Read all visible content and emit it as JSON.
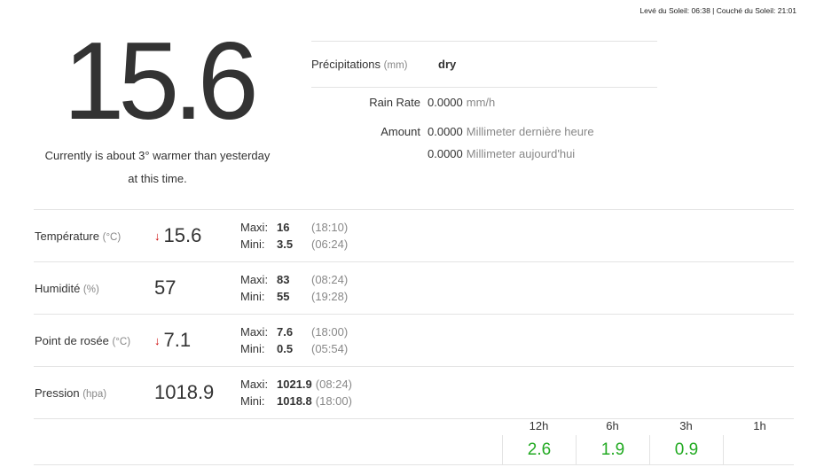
{
  "sun": {
    "text": "Levé du Soleil: 06:38 | Couché du Soleil: 21:01"
  },
  "current": {
    "temperature": "15.6",
    "comparison_line1": "Currently is about 3° warmer than yesterday",
    "comparison_line2": "at this time."
  },
  "rain": {
    "precip_label": "Précipitations",
    "precip_unit": "(mm)",
    "precip_value": "dry",
    "rate_label": "Rain Rate",
    "rate_value": "0.0000",
    "rate_unit": "mm/h",
    "amount_label": "Amount",
    "amount_hour_value": "0.0000",
    "amount_hour_desc": "Millimeter dernière heure",
    "amount_day_value": "0.0000",
    "amount_day_desc": "Millimeter aujourd'hui"
  },
  "observations": [
    {
      "name": "Température",
      "unit": "(°C)",
      "arrow": "↓",
      "value": "15.6",
      "max_label": "Maxi:",
      "max": "16",
      "max_time": "(18:10)",
      "min_label": "Mini:",
      "min": "3.5",
      "min_time": "(06:24)"
    },
    {
      "name": "Humidité",
      "unit": "(%)",
      "arrow": "",
      "value": "57",
      "max_label": "Maxi:",
      "max": "83",
      "max_time": "(08:24)",
      "min_label": "Mini:",
      "min": "55",
      "min_time": "(19:28)"
    },
    {
      "name": "Point de rosée",
      "unit": "(°C)",
      "arrow": "↓",
      "value": "7.1",
      "max_label": "Maxi:",
      "max": "7.6",
      "max_time": "(18:00)",
      "min_label": "Mini:",
      "min": "0.5",
      "min_time": "(05:54)"
    },
    {
      "name": "Pression",
      "unit": "(hpa)",
      "arrow": "",
      "value": "1018.9",
      "max_label": "Maxi:",
      "max": "1021.9",
      "max_time": "(08:24)",
      "min_label": "Mini:",
      "min": "1018.8",
      "min_time": "(18:00)"
    }
  ],
  "trend": [
    {
      "label": "12h",
      "value": "2.6"
    },
    {
      "label": "6h",
      "value": "1.9"
    },
    {
      "label": "3h",
      "value": "0.9"
    },
    {
      "label": "1h",
      "value": ""
    }
  ],
  "colors": {
    "trend_value": "#22aa22",
    "down_arrow": "#cc0000",
    "unit_gray": "#888888",
    "divider": "#e3e3e3"
  }
}
